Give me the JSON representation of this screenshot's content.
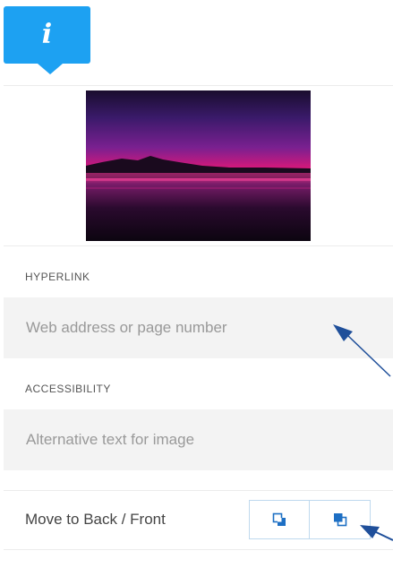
{
  "header": {
    "info_glyph": "i",
    "accent": "#1da1f2"
  },
  "hyperlink": {
    "label": "HYPERLINK",
    "placeholder": "Web address or page number",
    "value": ""
  },
  "accessibility": {
    "label": "ACCESSIBILITY",
    "placeholder": "Alternative text for image",
    "value": ""
  },
  "order": {
    "label": "Move to Back / Front",
    "back_icon": "send-to-back-icon",
    "front_icon": "bring-to-front-icon"
  }
}
